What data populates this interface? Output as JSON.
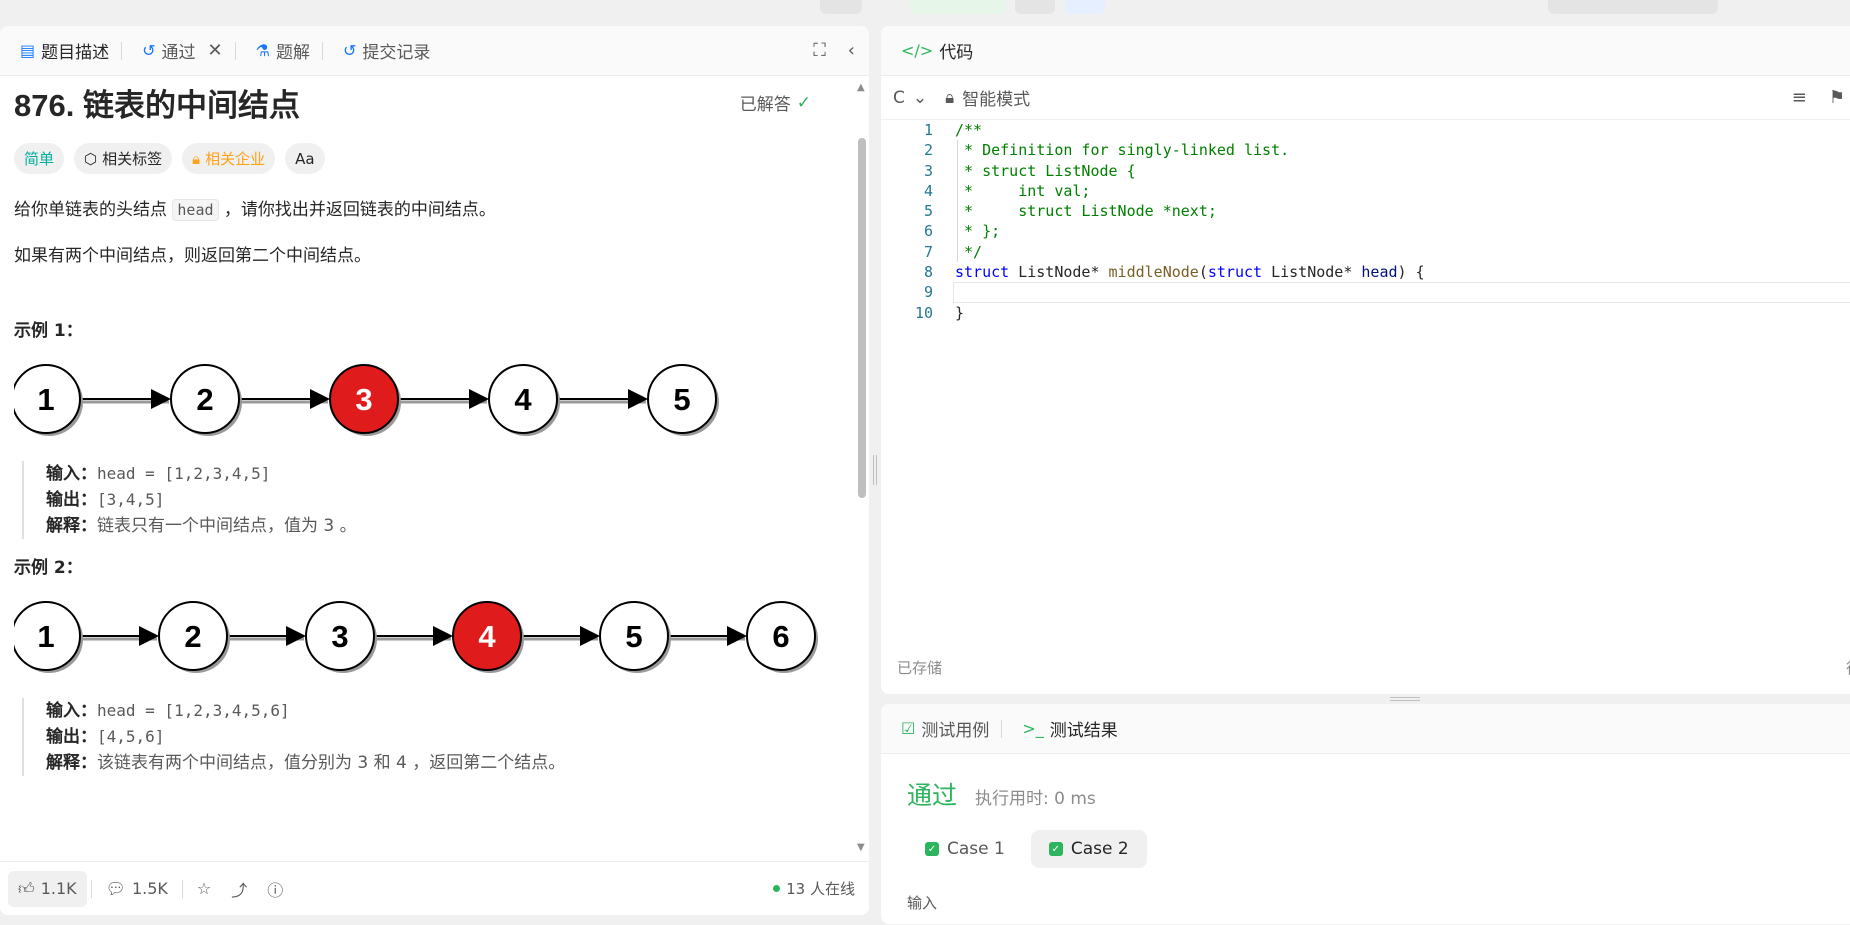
{
  "left": {
    "tabs": [
      {
        "label": "题目描述",
        "icon": "description-icon"
      },
      {
        "label": "通过",
        "icon": "history-icon"
      },
      {
        "label": "题解",
        "icon": "flask-icon"
      },
      {
        "label": "提交记录",
        "icon": "history-icon"
      }
    ],
    "problem_title": "876. 链表的中间结点",
    "solved_label": "已解答",
    "tags": {
      "difficulty": "简单",
      "related_tags": "相关标签",
      "companies": "相关企业",
      "translate": "Aa"
    },
    "desc1_prefix": "给你单链表的头结点 ",
    "desc1_code": "head",
    "desc1_suffix": " ，请你找出并返回链表的中间结点。",
    "desc2": "如果有两个中间结点，则返回第二个中间结点。",
    "example1": {
      "title": "示例 1：",
      "nodes": [
        "1",
        "2",
        "3",
        "4",
        "5"
      ],
      "highlight_index": 2,
      "input_label": "输入：",
      "input_value": "head = [1,2,3,4,5]",
      "output_label": "输出：",
      "output_value": "[3,4,5]",
      "explain_label": "解释：",
      "explain_value": "链表只有一个中间结点，值为 3 。"
    },
    "example2": {
      "title": "示例 2：",
      "nodes": [
        "1",
        "2",
        "3",
        "4",
        "5",
        "6"
      ],
      "highlight_index": 3,
      "input_label": "输入：",
      "input_value": "head = [1,2,3,4,5,6]",
      "output_label": "输出：",
      "output_value": "[4,5,6]",
      "explain_label": "解释：",
      "explain_value": "该链表有两个中间结点，值分别为 3 和 4 ，返回第二个结点。"
    },
    "bottom": {
      "likes": "1.1K",
      "comments": "1.5K",
      "online": "13 人在线"
    }
  },
  "code": {
    "tab_label": "代码",
    "language": "C",
    "mode": "智能模式",
    "line_numbers": [
      "1",
      "2",
      "3",
      "4",
      "5",
      "6",
      "7",
      "8",
      "9",
      "10"
    ],
    "saved_label": "已存储",
    "saved_right": "行"
  },
  "result": {
    "tab_testcase": "测试用例",
    "tab_result": "测试结果",
    "status": "通过",
    "runtime": "执行用时: 0 ms",
    "case1": "Case 1",
    "case2": "Case 2",
    "input_label": "输入"
  },
  "colors": {
    "accent_green": "#2db55d",
    "easy": "#00af9b",
    "company": "#ffa116",
    "node_highlight": "#e01b1b"
  }
}
